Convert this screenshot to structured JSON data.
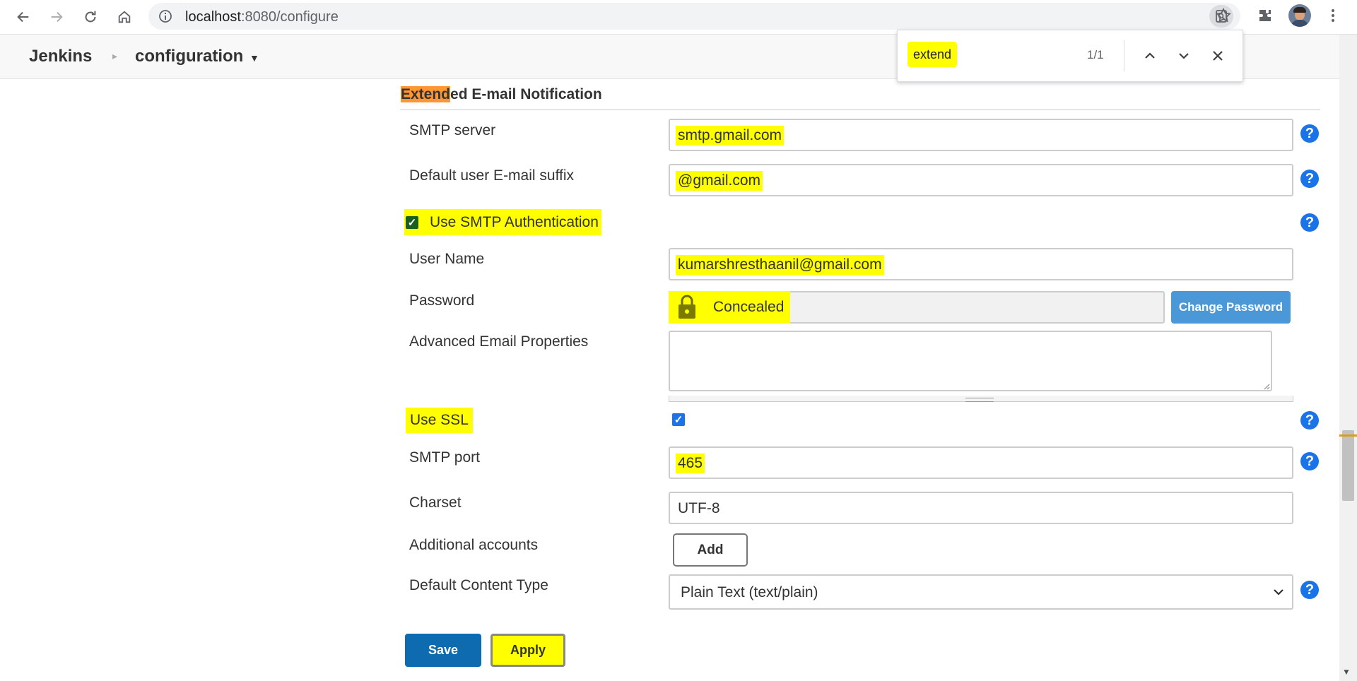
{
  "browser": {
    "url_host": "localhost",
    "url_rest": ":8080/configure",
    "icons": [
      "back-icon",
      "forward-icon",
      "reload-icon",
      "home-icon",
      "info-icon",
      "find-in-page-icon",
      "star-icon",
      "extensions-icon",
      "avatar",
      "more-menu-icon"
    ]
  },
  "breadcrumb": {
    "home": "Jenkins",
    "current": "configuration"
  },
  "find_bar": {
    "query": "extend",
    "count": "1/1"
  },
  "section": {
    "title_highlight": "Extend",
    "title_rest": "ed E-mail Notification"
  },
  "form": {
    "smtp_server_label": "SMTP server",
    "smtp_server_value": "smtp.gmail.com",
    "email_suffix_label": "Default user E-mail suffix",
    "email_suffix_value": "@gmail.com",
    "use_smtp_auth_label": "Use SMTP Authentication",
    "use_smtp_auth_checked": true,
    "user_name_label": "User Name",
    "user_name_value": "kumarshresthaanil@gmail.com",
    "password_label": "Password",
    "password_value": "Concealed",
    "change_password_label": "Change Password",
    "adv_email_label": "Advanced Email Properties",
    "adv_email_value": "",
    "use_ssl_label": "Use SSL",
    "use_ssl_checked": true,
    "smtp_port_label": "SMTP port",
    "smtp_port_value": "465",
    "charset_label": "Charset",
    "charset_value": "UTF-8",
    "additional_accounts_label": "Additional accounts",
    "add_label": "Add",
    "content_type_label": "Default Content Type",
    "content_type_value": "Plain Text (text/plain)"
  },
  "actions": {
    "save_label": "Save",
    "apply_label": "Apply"
  },
  "colors": {
    "find_highlight": "#ffff00",
    "active_match": "#ff9632",
    "help_icon": "#1a73e8",
    "save_button": "#0e6bb0",
    "change_password_button": "#4b98d8"
  }
}
